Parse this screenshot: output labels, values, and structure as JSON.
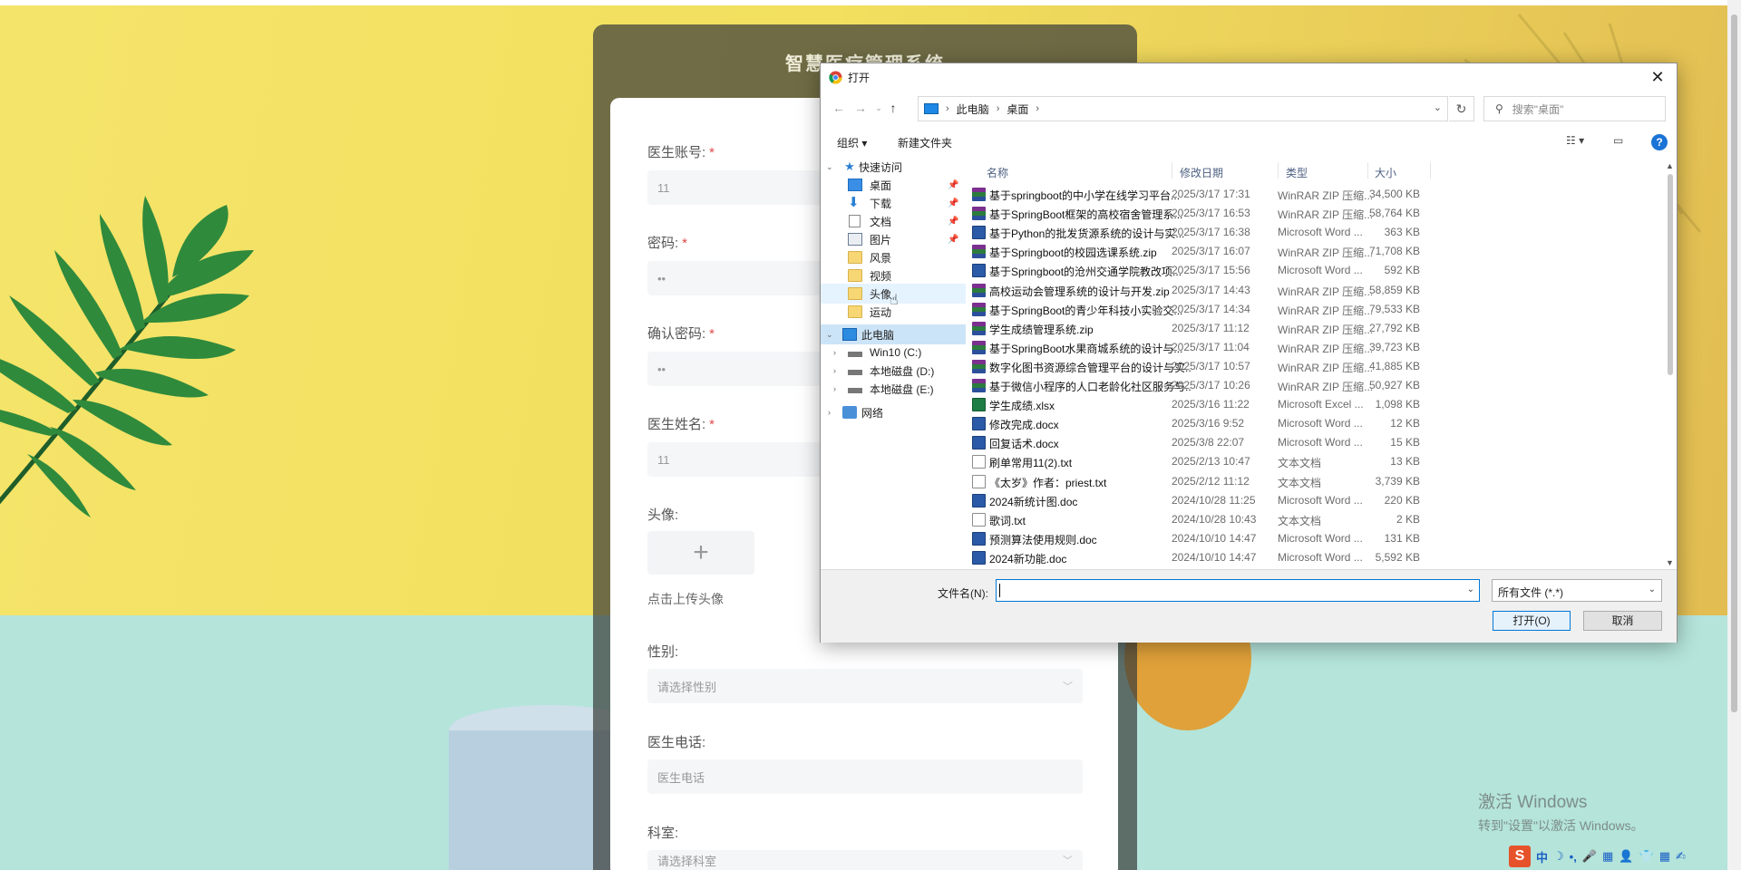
{
  "register": {
    "title": "智慧医疗管理系统",
    "fields": [
      {
        "label": "医生账号:",
        "required": true,
        "value": "11"
      },
      {
        "label": "密码:",
        "required": true,
        "value": "••"
      },
      {
        "label": "确认密码:",
        "required": true,
        "value": "••"
      },
      {
        "label": "医生姓名:",
        "required": true,
        "value": "11"
      }
    ],
    "avatar_label": "头像:",
    "avatar_plus": "+",
    "avatar_hint": "点击上传头像",
    "gender_label": "性别:",
    "gender_placeholder": "请选择性别",
    "phone_label": "医生电话:",
    "phone_placeholder": "医生电话",
    "dept_label": "科室:",
    "dept_placeholder": "请选择科室",
    "required_mark": "*"
  },
  "watermark": {
    "line1": "激活 Windows",
    "line2": "转到\"设置\"以激活 Windows。"
  },
  "dialog": {
    "title": "打开",
    "close": "✕",
    "path": [
      "此电脑",
      "桌面"
    ],
    "search_placeholder": "搜索\"桌面\"",
    "toolbar": {
      "organize": "组织 ▾",
      "new_folder": "新建文件夹",
      "view": "☷ ▾",
      "pane": "▭",
      "help": "?"
    },
    "nav": {
      "quick_access": "快速访问",
      "items": [
        {
          "label": "桌面",
          "icon": "desktop-folder-icon",
          "pinned": true
        },
        {
          "label": "下载",
          "icon": "download-icon",
          "pinned": true
        },
        {
          "label": "文档",
          "icon": "document-icon",
          "pinned": true
        },
        {
          "label": "图片",
          "icon": "picture-icon",
          "pinned": true
        },
        {
          "label": "风景",
          "icon": "folder-icon",
          "pinned": false
        },
        {
          "label": "视频",
          "icon": "folder-icon",
          "pinned": false
        },
        {
          "label": "头像",
          "icon": "folder-icon",
          "pinned": false
        },
        {
          "label": "运动",
          "icon": "folder-icon",
          "pinned": false
        }
      ],
      "this_pc": "此电脑",
      "drives": [
        "Win10 (C:)",
        "本地磁盘 (D:)",
        "本地磁盘 (E:)"
      ],
      "network": "网络"
    },
    "columns": {
      "name": "名称",
      "date": "修改日期",
      "type": "类型",
      "size": "大小"
    },
    "files": [
      {
        "name": "基于springboot的中小学在线学习平台...",
        "date": "2025/3/17 17:31",
        "type": "WinRAR ZIP 压缩...",
        "size": "34,500 KB",
        "icon": "zip"
      },
      {
        "name": "基于SpringBoot框架的高校宿舍管理系...",
        "date": "2025/3/17 16:53",
        "type": "WinRAR ZIP 压缩...",
        "size": "58,764 KB",
        "icon": "zip"
      },
      {
        "name": "基于Python的批发货源系统的设计与实...",
        "date": "2025/3/17 16:38",
        "type": "Microsoft Word ...",
        "size": "363 KB",
        "icon": "doc"
      },
      {
        "name": "基于Springboot的校园选课系统.zip",
        "date": "2025/3/17 16:07",
        "type": "WinRAR ZIP 压缩...",
        "size": "71,708 KB",
        "icon": "zip"
      },
      {
        "name": "基于Springboot的沧州交通学院教改项...",
        "date": "2025/3/17 15:56",
        "type": "Microsoft Word ...",
        "size": "592 KB",
        "icon": "doc"
      },
      {
        "name": "高校运动会管理系统的设计与开发.zip",
        "date": "2025/3/17 14:43",
        "type": "WinRAR ZIP 压缩...",
        "size": "58,859 KB",
        "icon": "zip"
      },
      {
        "name": "基于SpringBoot的青少年科技小实验交...",
        "date": "2025/3/17 14:34",
        "type": "WinRAR ZIP 压缩...",
        "size": "79,533 KB",
        "icon": "zip"
      },
      {
        "name": "学生成绩管理系统.zip",
        "date": "2025/3/17 11:12",
        "type": "WinRAR ZIP 压缩...",
        "size": "27,792 KB",
        "icon": "zip"
      },
      {
        "name": "基于SpringBoot水果商城系统的设计与...",
        "date": "2025/3/17 11:04",
        "type": "WinRAR ZIP 压缩...",
        "size": "39,723 KB",
        "icon": "zip"
      },
      {
        "name": "数字化图书资源综合管理平台的设计与实...",
        "date": "2025/3/17 10:57",
        "type": "WinRAR ZIP 压缩...",
        "size": "41,885 KB",
        "icon": "zip"
      },
      {
        "name": "基于微信小程序的人口老龄化社区服务与...",
        "date": "2025/3/17 10:26",
        "type": "WinRAR ZIP 压缩...",
        "size": "50,927 KB",
        "icon": "zip"
      },
      {
        "name": "学生成绩.xlsx",
        "date": "2025/3/16 11:22",
        "type": "Microsoft Excel ...",
        "size": "1,098 KB",
        "icon": "xls"
      },
      {
        "name": "修改完成.docx",
        "date": "2025/3/16 9:52",
        "type": "Microsoft Word ...",
        "size": "12 KB",
        "icon": "doc"
      },
      {
        "name": "回复话术.docx",
        "date": "2025/3/8 22:07",
        "type": "Microsoft Word ...",
        "size": "15 KB",
        "icon": "doc"
      },
      {
        "name": "刷单常用11(2).txt",
        "date": "2025/2/13 10:47",
        "type": "文本文档",
        "size": "13 KB",
        "icon": "txt"
      },
      {
        "name": "《太岁》作者：priest.txt",
        "date": "2025/2/12 11:12",
        "type": "文本文档",
        "size": "3,739 KB",
        "icon": "txt"
      },
      {
        "name": "2024新统计图.doc",
        "date": "2024/10/28 11:25",
        "type": "Microsoft Word ...",
        "size": "220 KB",
        "icon": "doc"
      },
      {
        "name": "歌词.txt",
        "date": "2024/10/28 10:43",
        "type": "文本文档",
        "size": "2 KB",
        "icon": "txt"
      },
      {
        "name": "预测算法使用规则.doc",
        "date": "2024/10/10 14:47",
        "type": "Microsoft Word ...",
        "size": "131 KB",
        "icon": "doc"
      },
      {
        "name": "2024新功能.doc",
        "date": "2024/10/10 14:47",
        "type": "Microsoft Word ...",
        "size": "5,592 KB",
        "icon": "doc"
      }
    ],
    "filename_label": "文件名(N):",
    "filename_value": "",
    "filter": "所有文件 (*.*)",
    "open_btn": "打开(O)",
    "cancel_btn": "取消"
  },
  "tray": {
    "ime_logo": "S",
    "items": [
      "中",
      "☽",
      "•,",
      "🎤",
      "▦",
      "👤",
      "👕",
      "▦",
      "✍"
    ]
  },
  "colors": {
    "accent": "#0078d7",
    "required": "#e04848",
    "selected": "#cce4f7"
  }
}
